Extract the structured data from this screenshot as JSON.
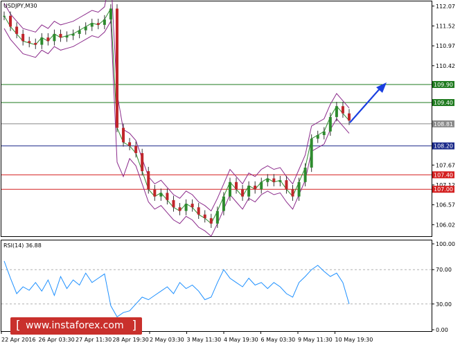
{
  "symbol_label": "USDJPY,M30",
  "rsi_label": "RSI(14) 36.88",
  "watermark": "www.instaforex.com",
  "chart_data": [
    {
      "type": "line",
      "title": "USDJPY,M30",
      "ylim": [
        105.7,
        112.2
      ],
      "y_ticks": [
        "112.07",
        "111.52",
        "110.97",
        "110.42",
        "109.90",
        "109.40",
        "108.81",
        "108.20",
        "107.67",
        "107.40",
        "107.12",
        "107.00",
        "106.57",
        "106.02"
      ],
      "levels": [
        {
          "value": 109.9,
          "label": "109.90",
          "color": "#1e7a1e"
        },
        {
          "value": 109.4,
          "label": "109.40",
          "color": "#1e7a1e"
        },
        {
          "value": 108.81,
          "label": "108.81",
          "color": "#8a8a8a"
        },
        {
          "value": 108.2,
          "label": "108.20",
          "color": "#1b2a8a"
        },
        {
          "value": 107.4,
          "label": "107.40",
          "color": "#d42020"
        },
        {
          "value": 107.0,
          "label": "107.00",
          "color": "#d42020"
        }
      ],
      "x_labels": [
        "22 Apr 2016",
        "26 Apr 03:30",
        "27 Apr 11:30",
        "28 Apr 19:30",
        "2 May 03:30",
        "3 May 11:30",
        "4 May 19:30",
        "6 May 03:30",
        "9 May 11:30",
        "10 May 19:30"
      ],
      "series": [
        {
          "values": [
            111.8,
            111.5,
            111.3,
            111.1,
            111.05,
            111.0,
            111.2,
            111.1,
            111.3,
            111.2,
            111.25,
            111.3,
            111.4,
            111.5,
            111.6,
            111.55,
            111.7,
            112.0,
            108.7,
            108.3,
            108.2,
            108.0,
            107.5,
            107.0,
            106.8,
            106.9,
            106.7,
            106.5,
            106.4,
            106.6,
            106.5,
            106.3,
            106.2,
            106.05,
            106.4,
            106.8,
            107.2,
            107.0,
            106.8,
            107.1,
            107.0,
            107.2,
            107.3,
            107.2,
            107.25,
            107.0,
            106.8,
            107.2,
            107.6,
            108.4,
            108.5,
            108.6,
            109.0,
            109.3,
            109.1,
            108.9
          ]
        }
      ]
    },
    {
      "type": "line",
      "title": "RSI(14) 36.88",
      "ylim": [
        0,
        100
      ],
      "y_ticks": [
        "100.00",
        "70.00",
        "30.00",
        "0.00"
      ],
      "series": [
        {
          "values": [
            80,
            60,
            42,
            50,
            46,
            55,
            45,
            58,
            40,
            62,
            48,
            58,
            52,
            66,
            55,
            60,
            65,
            28,
            15,
            20,
            22,
            30,
            38,
            35,
            40,
            45,
            50,
            42,
            55,
            48,
            52,
            45,
            35,
            38,
            55,
            70,
            60,
            55,
            50,
            60,
            52,
            55,
            48,
            55,
            50,
            42,
            38,
            55,
            62,
            70,
            75,
            68,
            62,
            66,
            55,
            30
          ]
        }
      ]
    }
  ]
}
